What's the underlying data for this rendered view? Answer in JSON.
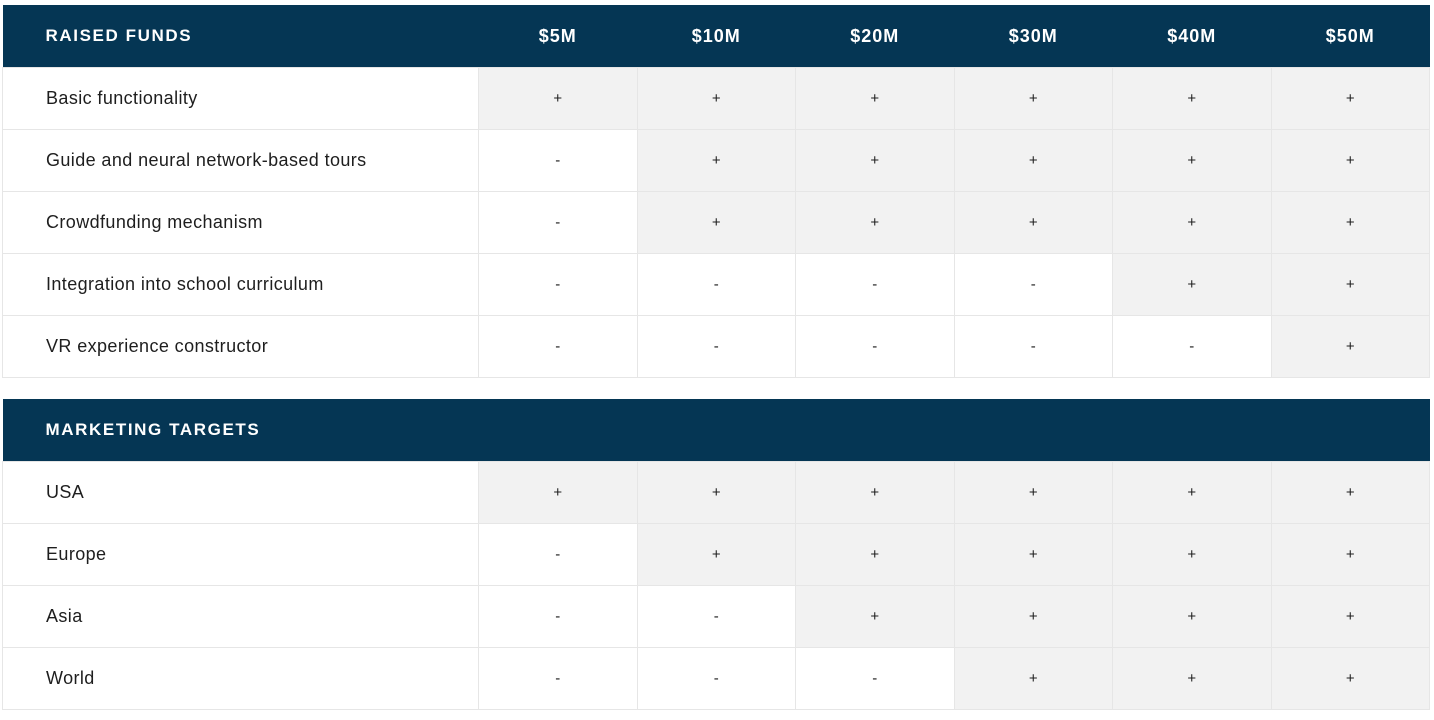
{
  "funds": {
    "header_label": "RAISED FUNDS",
    "tiers": [
      "$5M",
      "$10M",
      "$20M",
      "$30M",
      "$40M",
      "$50M"
    ],
    "rows": [
      {
        "label": "Basic functionality",
        "cells": [
          "+",
          "+",
          "+",
          "+",
          "+",
          "+"
        ]
      },
      {
        "label": "Guide and neural network-based tours",
        "cells": [
          "-",
          "+",
          "+",
          "+",
          "+",
          "+"
        ]
      },
      {
        "label": "Crowdfunding mechanism",
        "cells": [
          "-",
          "+",
          "+",
          "+",
          "+",
          "+"
        ]
      },
      {
        "label": "Integration into school curriculum",
        "cells": [
          "-",
          "-",
          "-",
          "-",
          "+",
          "+"
        ]
      },
      {
        "label": "VR experience constructor",
        "cells": [
          "-",
          "-",
          "-",
          "-",
          "-",
          "+"
        ]
      }
    ]
  },
  "marketing": {
    "header_label": "MARKETING TARGETS",
    "rows": [
      {
        "label": "USA",
        "cells": [
          "+",
          "+",
          "+",
          "+",
          "+",
          "+"
        ]
      },
      {
        "label": "Europe",
        "cells": [
          "-",
          "+",
          "+",
          "+",
          "+",
          "+"
        ]
      },
      {
        "label": "Asia",
        "cells": [
          "-",
          "-",
          "+",
          "+",
          "+",
          "+"
        ]
      },
      {
        "label": "World",
        "cells": [
          "-",
          "-",
          "-",
          "+",
          "+",
          "+"
        ]
      }
    ]
  },
  "colors": {
    "header_bg": "#053654",
    "header_text": "#ffffff",
    "included_bg": "#f2f2f2",
    "excluded_bg": "#ffffff",
    "border": "#e6e6e6"
  }
}
